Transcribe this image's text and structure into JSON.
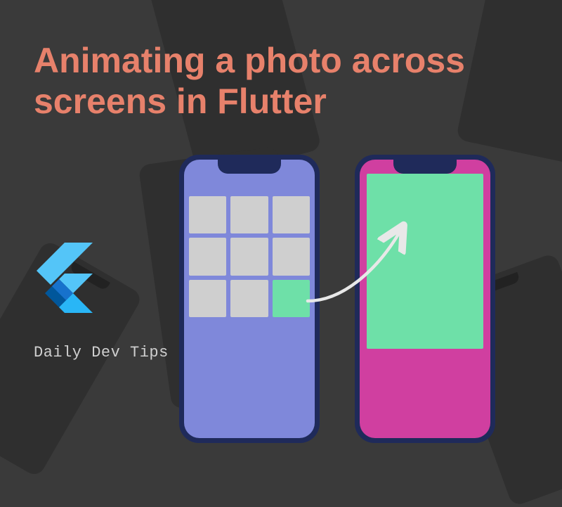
{
  "headline": "Animating a photo across screens in Flutter",
  "brand": "Daily Dev Tips",
  "colors": {
    "headline": "#E7816B",
    "bg": "#3a3a3a",
    "phone_left_screen": "#7f88da",
    "phone_right_screen": "#d03fa0",
    "highlight": "#6ee0a8",
    "grid_cell": "#cfcfcf"
  },
  "grid": {
    "rows": 3,
    "cols": 3,
    "highlighted_index": 8
  }
}
